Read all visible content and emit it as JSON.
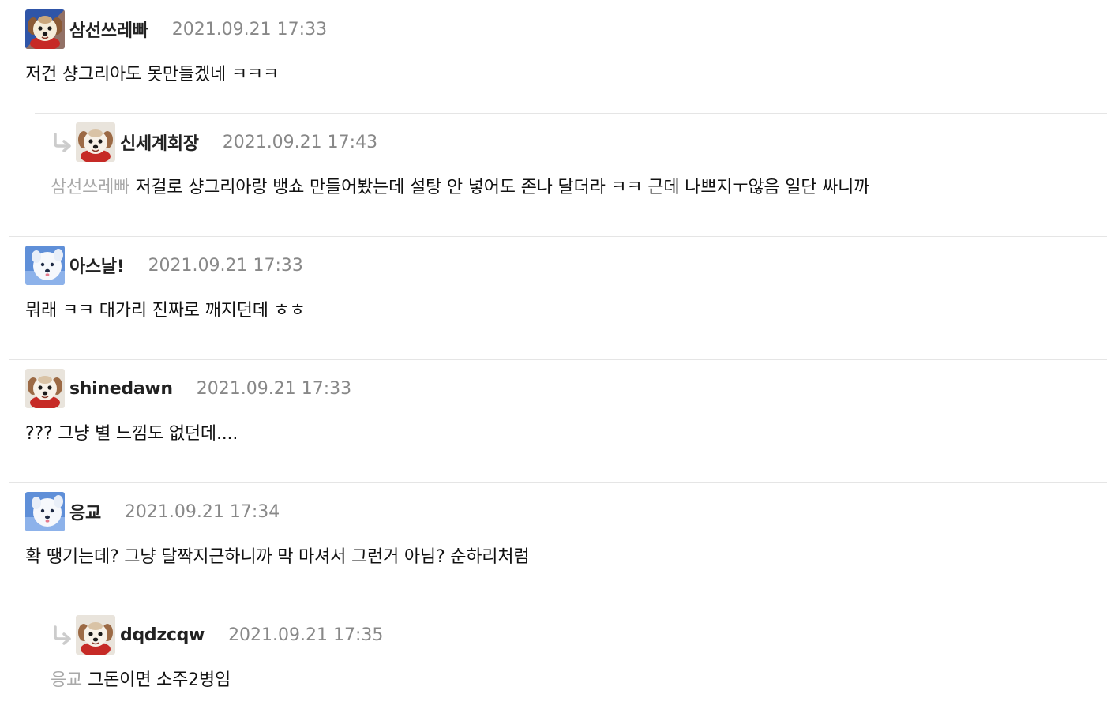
{
  "comments": [
    {
      "nickname": "삼선쓰레빠",
      "date": "2021.09.21 17:33",
      "text": "저건 샹그리아도 못만들겠네 ㅋㅋㅋ",
      "avatar": "puppy-red-scarf-blue-bg"
    },
    {
      "nickname": "신세계회장",
      "date": "2021.09.21 17:43",
      "mention": "삼선쓰레빠",
      "text": "저걸로 샹그리아랑 뱅쇼 만들어봤는데 설탕 안 넣어도 존나 달더라 ㅋㅋ 근데 나쁘지ㅜ않음 일단 싸니까",
      "avatar": "puppy-red-scarf"
    },
    {
      "nickname": "아스날!",
      "date": "2021.09.21 17:33",
      "text": "뭐래 ㅋㅋ 대가리 진짜로 깨지던데 ㅎㅎ",
      "avatar": "white-dog-blue-bg"
    },
    {
      "nickname": "shinedawn",
      "date": "2021.09.21 17:33",
      "text": "??? 그냥 별 느낌도 없던데....",
      "avatar": "puppy-red-scarf"
    },
    {
      "nickname": "응교",
      "date": "2021.09.21 17:34",
      "text": "확 땡기는데? 그냥 달짝지근하니까 막 마셔서 그런거 아님? 순하리처럼",
      "avatar": "white-dog-blue-bg"
    },
    {
      "nickname": "dqdzcqw",
      "date": "2021.09.21 17:35",
      "mention": "응교",
      "text": "그돈이면 소주2병임",
      "avatar": "puppy-red-scarf"
    }
  ],
  "icons": {
    "reply": "reply-arrow-icon"
  },
  "colors": {
    "nickname": "#222222",
    "date": "#888888",
    "mention": "#a9a9a9",
    "divider": "#e5e5e5"
  }
}
